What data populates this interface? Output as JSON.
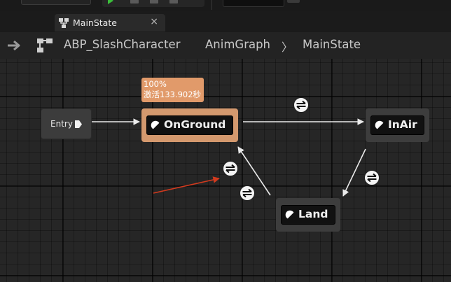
{
  "tab": {
    "label": "MainState",
    "close_glyph": "×"
  },
  "breadcrumb": {
    "items": [
      "ABP_SlashCharacter",
      "AnimGraph",
      "MainState"
    ],
    "separator": "〉"
  },
  "graph": {
    "entry": {
      "label": "Entry"
    },
    "states": {
      "onground": {
        "label": "OnGround",
        "active": true,
        "accent": "#d4996e"
      },
      "inair": {
        "label": "InAir"
      },
      "land": {
        "label": "Land"
      }
    },
    "tooltip": {
      "weight": "100%",
      "active_time": "激活133.902秒"
    },
    "transitions": [
      "transition-onground-to-inair",
      "transition-land-to-onground",
      "transition-onground-to-land",
      "transition-inair-to-land"
    ],
    "colors": {
      "wire": "#eaeaea",
      "annotation_arrow": "#d23a1e",
      "active_state": "#d4996e",
      "tooltip": "#e19a6a",
      "play": "#3bbf3b"
    }
  }
}
